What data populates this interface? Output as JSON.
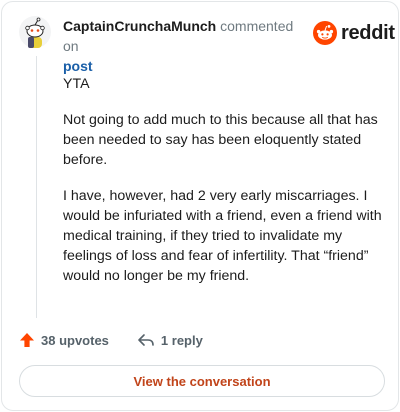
{
  "header": {
    "author": "CaptainCrunchaMunch",
    "action": "commented on",
    "post_link": "post",
    "logo_text": "reddit"
  },
  "comment": {
    "paragraphs": [
      "YTA",
      "Not going to add much to this because all that has been needed to say has been eloquently stated before.",
      "I have, however, had 2 very early miscarriages. I would be infuriated with a friend, even a friend with medical training, if they tried to invalidate my feelings of loss and fear of infertility. That “friend” would no longer be my friend."
    ]
  },
  "actions": {
    "upvotes": "38 upvotes",
    "replies": "1 reply"
  },
  "footer": {
    "view_button": "View the conversation"
  },
  "colors": {
    "brand": "#ff4500",
    "link": "#1a5fa8",
    "view_button_text": "#c1441a"
  }
}
